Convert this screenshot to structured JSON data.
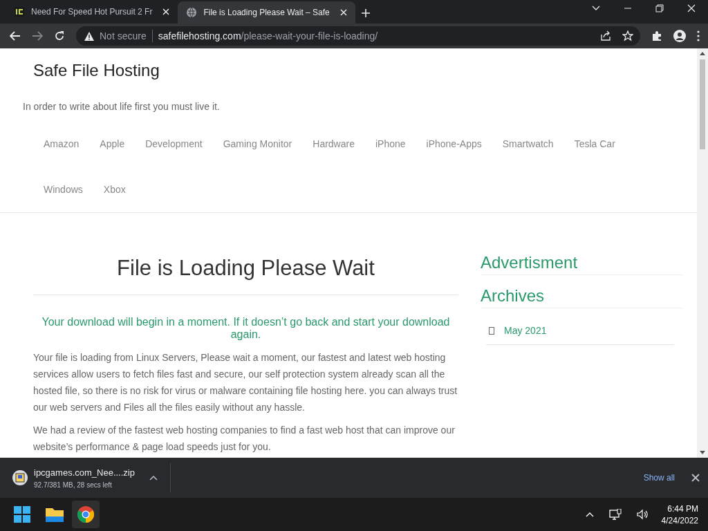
{
  "browser": {
    "tabs": [
      {
        "title": "Need For Speed Hot Pursuit 2 Fr",
        "kind": "ipc",
        "selected": false
      },
      {
        "title": "File is Loading Please Wait – Safe",
        "kind": "globe",
        "selected": true
      }
    ],
    "address": {
      "security": "Not secure",
      "domain": "safefilehosting.com",
      "path": "/please-wait-your-file-is-loading/"
    }
  },
  "site": {
    "title": "Safe File Hosting",
    "tagline": "In order to write about life first you must live it.",
    "nav": [
      "Amazon",
      "Apple",
      "Development",
      "Gaming Monitor",
      "Hardware",
      "iPhone",
      "iPhone-Apps",
      "Smartwatch",
      "Tesla Car",
      "Windows",
      "Xbox"
    ]
  },
  "article": {
    "title": "File is Loading Please Wait",
    "notice": "Your download will begin in a moment. If it doesn’t go back and start your download again.",
    "paragraphs": [
      "Your file is loading from Linux Servers, Please wait a moment, our fastest and latest web hosting services allow users to fetch files fast and secure, our self protection system already scan all the hosted file, so there is no risk for virus or malware containing file hosting here. you can always trust our web servers and Files all the files easily without any hassle.",
      "We had a review of the fastest web hosting companies to find a fast web host that can improve our website’s performance & page load speeds just for you."
    ]
  },
  "sidebar": {
    "widgets": [
      {
        "title": "Advertisment"
      },
      {
        "title": "Archives",
        "items": [
          "May 2021"
        ]
      }
    ]
  },
  "download_bar": {
    "file": "ipcgames.com_Nee....zip",
    "status": "92.7/381 MB, 28 secs left",
    "show_all": "Show all"
  },
  "taskbar": {
    "time": "6:44 PM",
    "date": "4/24/2022"
  }
}
